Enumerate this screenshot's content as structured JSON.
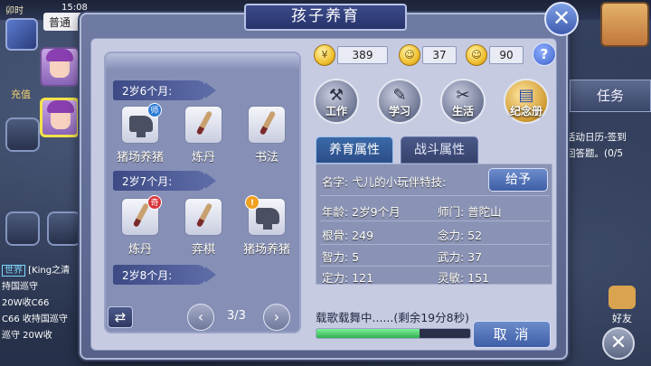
{
  "hud": {
    "time_label": "卯时",
    "clock": "15:08",
    "name": "普通",
    "chongzhi": "充值",
    "chat": [
      {
        "tag": "世界",
        "text": "[King之清"
      },
      {
        "tag": "",
        "text": "持国巡守"
      },
      {
        "tag": "",
        "text": "20W收C66"
      },
      {
        "tag": "",
        "text": "C66 收持国巡守"
      },
      {
        "tag": "",
        "text": "巡守 20W收"
      }
    ],
    "right_tab": "任务",
    "right_text_1": "活动日历-签到",
    "right_text_2": "回答题。(0/5",
    "friend_label": "好友",
    "close2": "✕"
  },
  "dialog": {
    "title": "孩子养育",
    "close": "✕",
    "currency": [
      {
        "icon": "coin-icon",
        "value": "389"
      },
      {
        "icon": "smile-icon",
        "value": "37"
      },
      {
        "icon": "content-face-icon",
        "value": "90"
      }
    ],
    "help": "?",
    "top_actions": [
      {
        "label": "工作",
        "icon": "anvil-icon"
      },
      {
        "label": "学习",
        "icon": "brush-icon"
      },
      {
        "label": "生活",
        "icon": "tools-icon"
      },
      {
        "label": "纪念册",
        "icon": "album-icon"
      }
    ],
    "tabs": [
      "养育属性",
      "战斗属性"
    ],
    "schedule": [
      {
        "age": "2岁6个月:",
        "items": [
          {
            "label": "猪场养猪",
            "icon": "anvil-icon",
            "badge": "师",
            "badge_type": "blue"
          },
          {
            "label": "炼丹",
            "icon": "brush-icon",
            "badge": "",
            "badge_type": ""
          },
          {
            "label": "书法",
            "icon": "brush-icon",
            "badge": "",
            "badge_type": ""
          }
        ]
      },
      {
        "age": "2岁7个月:",
        "items": [
          {
            "label": "炼丹",
            "icon": "brush-icon",
            "badge": "奇",
            "badge_type": "red"
          },
          {
            "label": "弈棋",
            "icon": "brush-icon",
            "badge": "",
            "badge_type": ""
          },
          {
            "label": "猪场养猪",
            "icon": "anvil-icon",
            "badge": "!",
            "badge_type": "warn"
          }
        ]
      },
      {
        "age": "2岁8个月:",
        "items": []
      }
    ],
    "pager": {
      "text": "3/3",
      "prev": "‹",
      "next": "›",
      "swap": "⇄"
    },
    "info": {
      "name_line": "名字: 弋儿的小玩伴特技:",
      "give_button": "给予",
      "rows": [
        {
          "left": "年龄: 2岁9个月",
          "right": "师门: 普陀山"
        },
        {
          "left": "根骨: 249",
          "right": "念力: 52"
        },
        {
          "left": "智力: 5",
          "right": "武力: 37"
        },
        {
          "left": "定力: 121",
          "right": "灵敏: 151"
        }
      ]
    },
    "status": "载歌载舞中......(剩余19分8秒)",
    "progress": 0.67,
    "cancel": "取 消"
  }
}
